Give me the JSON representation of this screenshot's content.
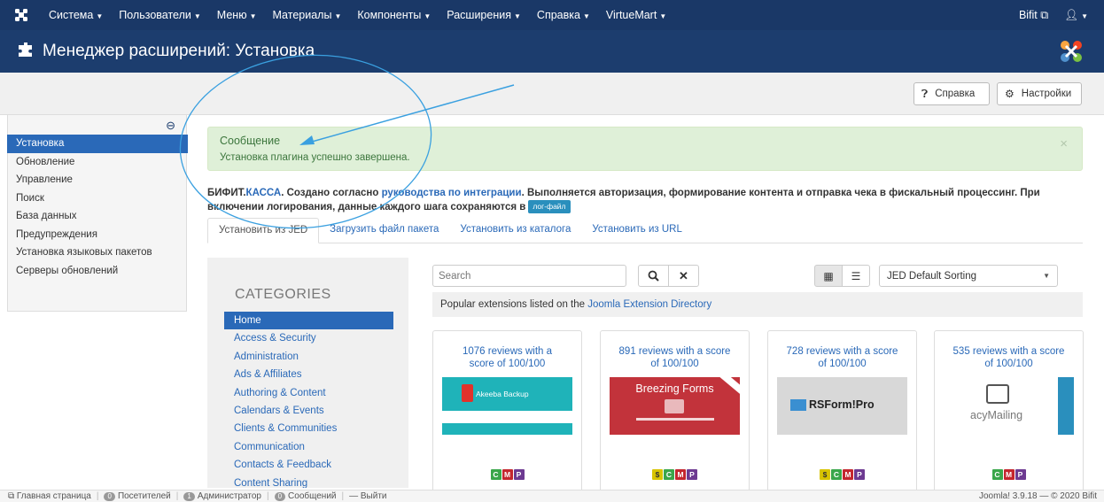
{
  "topbar": {
    "menu": [
      "Система",
      "Пользователи",
      "Меню",
      "Материалы",
      "Компоненты",
      "Расширения",
      "Справка",
      "VirtueMart"
    ],
    "user_link": "Bifit",
    "user_icon": "user-icon"
  },
  "header": {
    "title": "Менеджер расширений: Установка"
  },
  "toolbar": {
    "help_label": "Справка",
    "settings_label": "Настройки"
  },
  "sidebar": {
    "items": [
      "Установка",
      "Обновление",
      "Управление",
      "Поиск",
      "База данных",
      "Предупреждения",
      "Установка языковых пакетов",
      "Серверы обновлений"
    ],
    "active_index": 0
  },
  "alert": {
    "title": "Сообщение",
    "text": "Установка плагина успешно завершена.",
    "close": "×",
    "color": "#dff0d8"
  },
  "description": {
    "brand_bold": "БИФИТ.",
    "brand_link": "КАССА",
    "text1": ". Создано согласно ",
    "guide_link": "руководства по интеграции",
    "text2": ". Выполняется авторизация, формирование контента и отправка чека в фискальный процессинг. При включении логирования, данные каждого шага сохраняются в",
    "badge": "лог-файл"
  },
  "tabs": [
    "Установить из JED",
    "Загрузить файл пакета",
    "Установить из каталога",
    "Установить из URL"
  ],
  "categories": {
    "title": "CATEGORIES",
    "items": [
      "Home",
      "Access & Security",
      "Administration",
      "Ads & Affiliates",
      "Authoring & Content",
      "Calendars & Events",
      "Clients & Communities",
      "Communication",
      "Contacts & Feedback",
      "Content Sharing"
    ]
  },
  "search": {
    "placeholder": "Search",
    "sort_value": "JED Default Sorting"
  },
  "popular": {
    "text": "Popular extensions listed on the ",
    "link": "Joomla Extension Directory"
  },
  "cards": [
    {
      "reviews": "1076 reviews with a score of 100/100",
      "name": "Akeeba Backup",
      "badges": [
        "C",
        "M",
        "P"
      ]
    },
    {
      "reviews": "891 reviews with a score of 100/100",
      "name": "Breezing Forms",
      "badges": [
        "$",
        "C",
        "M",
        "P"
      ]
    },
    {
      "reviews": "728 reviews with a score of 100/100",
      "name": "RSForm!Pro",
      "badges": [
        "$",
        "C",
        "M",
        "P"
      ]
    },
    {
      "reviews": "535 reviews with a score of 100/100",
      "name": "acyMailing",
      "badges": [
        "C",
        "M",
        "P"
      ]
    }
  ],
  "statusbar": {
    "home": "Главная страница",
    "visitors_count": "0",
    "visitors": "Посетителей",
    "admins_count": "1",
    "admins": "Администратор",
    "messages_count": "0",
    "messages": "Сообщений",
    "logout": "Выйти",
    "version": "Joomla! 3.9.18  —  © 2020 Bifit"
  },
  "colors": {
    "navbar": "#1a3867",
    "header": "#1c3d6e",
    "accent": "#2a69b8",
    "annotation": "#3aa0e0"
  }
}
